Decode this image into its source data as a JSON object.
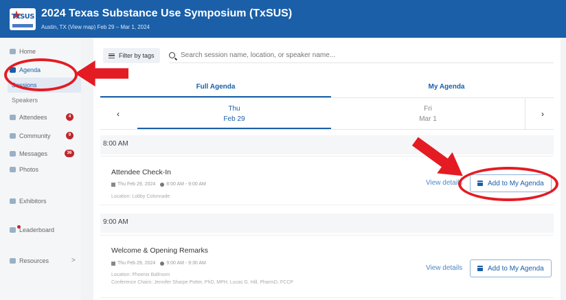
{
  "event": {
    "logo_text": "TxSUS",
    "title": "2024 Texas Substance Use Symposium (TxSUS)",
    "subtitle": "Austin, TX (View map)  Feb 29 – Mar 1, 2024"
  },
  "sidebar": {
    "home": "Home",
    "agenda": "Agenda",
    "sessions": "Sessions",
    "speakers": "Speakers",
    "attendees": "Attendees",
    "attendees_badge": "4",
    "community": "Community",
    "community_badge": "9",
    "messages": "Messages",
    "messages_badge": "36",
    "photos": "Photos",
    "exhibitors": "Exhibitors",
    "leaderboard": "Leaderboard",
    "resources": "Resources"
  },
  "toolbar": {
    "filter_label": "Filter by tags",
    "search_placeholder": "Search session name, location, or speaker name..."
  },
  "tabs": {
    "full_agenda": "Full Agenda",
    "my_agenda": "My Agenda"
  },
  "days": [
    {
      "weekday": "Thu",
      "date": "Feb 29"
    },
    {
      "weekday": "Fri",
      "date": "Mar 1"
    }
  ],
  "day_nav": {
    "prev": "‹",
    "next": "›"
  },
  "times": [
    "8:00 AM",
    "9:00 AM"
  ],
  "sessions": [
    {
      "title": "Attendee Check-In",
      "date": "Thu Feb 29, 2024",
      "time": "8:00 AM - 9:00 AM",
      "location": "Location: Lobby Colonnade",
      "view_details": "View details",
      "add_label": "Add to My Agenda"
    },
    {
      "title": "Welcome & Opening Remarks",
      "date": "Thu Feb 29, 2024",
      "time": "9:00 AM - 9:30 AM",
      "location": "Location: Phoenix Ballroom",
      "chairs": "Conference Chairs: Jennifer Sharpe Potter, PhD, MPH; Lucas G. Hill, PharmD, FCCP",
      "view_details": "View details",
      "add_label": "Add to My Agenda"
    }
  ],
  "colors": {
    "brand": "#1a5fa8",
    "annotation": "#e41b23",
    "badge": "#c0272d"
  }
}
